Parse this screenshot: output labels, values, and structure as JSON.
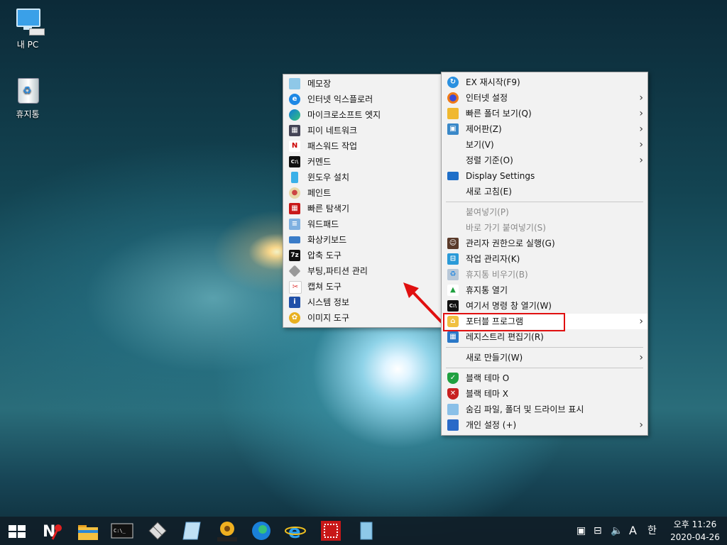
{
  "desktop": {
    "icons": [
      {
        "label": "내 PC"
      },
      {
        "label": "휴지통"
      }
    ]
  },
  "context_menu": {
    "items": [
      {
        "label": "EX 재시작(F9)",
        "icon": "refresh-icon",
        "submenu": false
      },
      {
        "label": "인터넷 설정",
        "icon": "firefox-icon",
        "submenu": true
      },
      {
        "label": "빠른 폴더 보기(Q)",
        "icon": "folder-icon",
        "submenu": true
      },
      {
        "label": "제어판(Z)",
        "icon": "control-panel-icon",
        "submenu": true
      },
      {
        "label": "보기(V)",
        "icon": "",
        "submenu": true
      },
      {
        "label": "정렬 기준(O)",
        "icon": "",
        "submenu": true
      },
      {
        "label": "Display Settings",
        "icon": "monitor-icon",
        "submenu": false
      },
      {
        "label": "새로 고침(E)",
        "icon": "",
        "submenu": false
      },
      {
        "label": "붙여넣기(P)",
        "icon": "",
        "submenu": false,
        "disabled": true
      },
      {
        "label": "바로 가기 붙여넣기(S)",
        "icon": "",
        "submenu": false,
        "disabled": true
      },
      {
        "label": "관리자 권한으로 실행(G)",
        "icon": "admin-icon",
        "submenu": false
      },
      {
        "label": "작업 관리자(K)",
        "icon": "task-manager-icon",
        "submenu": false
      },
      {
        "label": "휴지통 비우기(B)",
        "icon": "recycle-icon",
        "submenu": false,
        "disabled": true
      },
      {
        "label": "휴지통 열기",
        "icon": "recycle-open-icon",
        "submenu": false
      },
      {
        "label": "여기서 명령 창 열기(W)",
        "icon": "cmd-icon",
        "submenu": false
      },
      {
        "label": "포터블 프로그램",
        "icon": "lock-icon",
        "submenu": true
      },
      {
        "label": "레지스트리 편집기(R)",
        "icon": "registry-icon",
        "submenu": false
      },
      {
        "label": "새로 만들기(W)",
        "icon": "",
        "submenu": true
      },
      {
        "label": "블랙 테마 O",
        "icon": "shield-green-icon",
        "submenu": false
      },
      {
        "label": "블랙 테마 X",
        "icon": "shield-red-icon",
        "submenu": false
      },
      {
        "label": "숨김 파일, 폴더 및 드라이브 표시",
        "icon": "hidden-files-icon",
        "submenu": false
      },
      {
        "label": "개인 설정 (+)",
        "icon": "personalize-icon",
        "submenu": true
      }
    ]
  },
  "portable_submenu": {
    "items": [
      {
        "label": "메모장",
        "icon": "notepad-icon"
      },
      {
        "label": "인터넷 익스플로러",
        "icon": "ie-icon"
      },
      {
        "label": "마이크로소프트 엣지",
        "icon": "edge-icon"
      },
      {
        "label": "피이 네트워크",
        "icon": "network-icon"
      },
      {
        "label": "패스워드 작업",
        "icon": "password-icon"
      },
      {
        "label": "커멘드",
        "icon": "cmd-icon"
      },
      {
        "label": "윈도우 설치",
        "icon": "install-icon"
      },
      {
        "label": "페인트",
        "icon": "paint-icon"
      },
      {
        "label": "빠른 탐색기",
        "icon": "explorer-icon"
      },
      {
        "label": "워드패드",
        "icon": "wordpad-icon"
      },
      {
        "label": "화상키보드",
        "icon": "keyboard-icon"
      },
      {
        "label": "압축 도구",
        "icon": "7zip-icon"
      },
      {
        "label": "부팅,파티션 관리",
        "icon": "partition-icon"
      },
      {
        "label": "캡쳐 도구",
        "icon": "snipping-icon"
      },
      {
        "label": "시스템 정보",
        "icon": "sysinfo-icon"
      },
      {
        "label": "이미지 도구",
        "icon": "image-tool-icon"
      }
    ]
  },
  "taskbar": {
    "tray_lang": "A",
    "tray_ime": "한",
    "time": "오후 11:26",
    "date": "2020-04-26"
  },
  "colors": {
    "highlight_box": "#e01010",
    "arrow": "#e01010",
    "menu_bg": "#f2f2f2"
  }
}
